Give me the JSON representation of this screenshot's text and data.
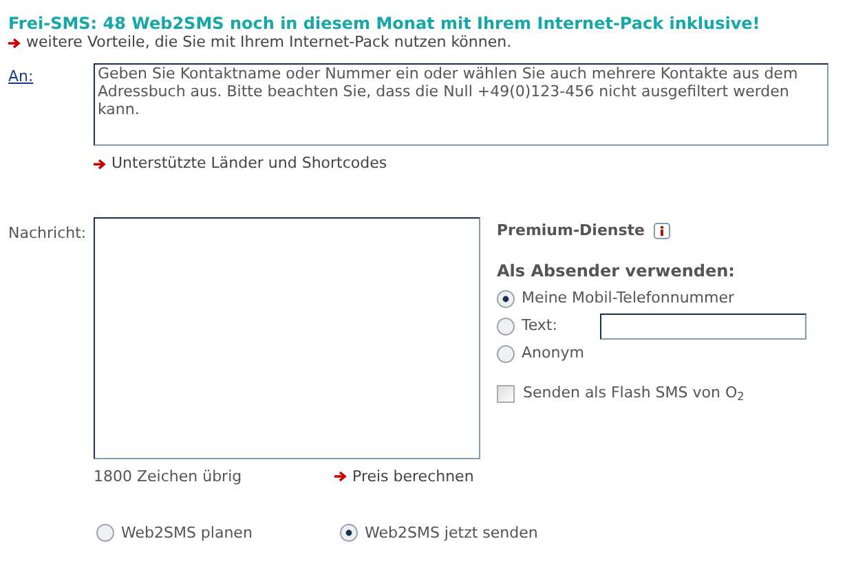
{
  "banner": {
    "title": "Frei-SMS: 48 Web2SMS noch in diesem Monat mit Ihrem Internet-Pack inklusive!",
    "link": "weitere Vorteile, die Sie mit Ihrem Internet-Pack nutzen können."
  },
  "recipient": {
    "label": "An:",
    "value": "Geben Sie Kontaktname oder Nummer ein oder wählen Sie auch mehrere Kontakte aus dem Adressbuch aus. Bitte beachten Sie, dass die Null +49(0)123-456 nicht ausgefiltert werden kann.",
    "link": "Unterstützte Länder und Shortcodes"
  },
  "message": {
    "label": "Nachricht:",
    "counter": "1800 Zeichen übrig",
    "price_link": "Preis berechnen"
  },
  "premium": {
    "title": "Premium-Dienste",
    "sender_heading": "Als Absender verwenden:",
    "sender_options": [
      {
        "kind": "radio",
        "label": "Meine Mobil-Telefonnummer",
        "selected": true
      },
      {
        "kind": "text-input",
        "label": "Text:",
        "selected": false
      },
      {
        "kind": "radio",
        "label": "Anonym",
        "selected": false
      }
    ],
    "flash": {
      "label": "Senden als Flash SMS von O$_{2}$",
      "checked": false
    }
  },
  "send_options": [
    {
      "label": "Web2SMS planen",
      "selected": false
    },
    {
      "label": "Web2SMS jetzt senden",
      "selected": true
    }
  ]
}
